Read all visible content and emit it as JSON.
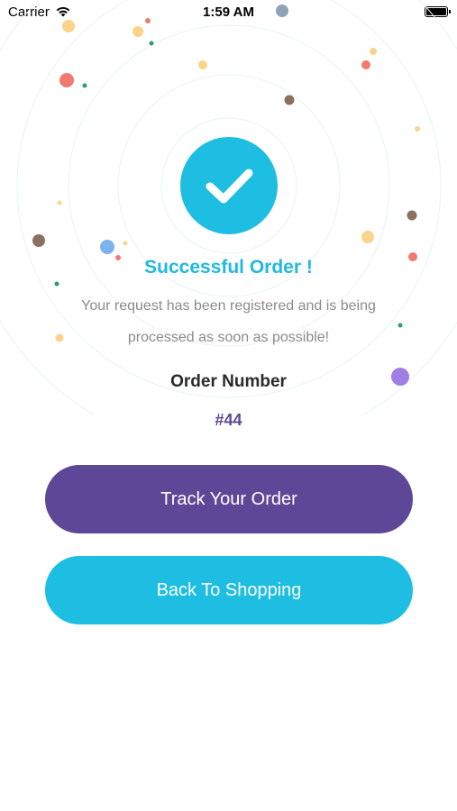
{
  "status_bar": {
    "carrier": "Carrier",
    "time": "1:59 AM",
    "wifi_icon": "wifi-icon",
    "battery_icon": "battery-full-icon"
  },
  "success": {
    "icon": "checkmark-icon",
    "title": "Successful Order !",
    "description": "Your request has been registered and is being processed as soon as possible!"
  },
  "order": {
    "label": "Order Number",
    "number": "#44"
  },
  "buttons": {
    "track": "Track Your Order",
    "back": "Back To Shopping"
  },
  "colors": {
    "primary_purple": "#5e4796",
    "primary_cyan": "#1ebde2",
    "title_cyan": "#21b9de",
    "text_gray": "#8b8b8b"
  }
}
